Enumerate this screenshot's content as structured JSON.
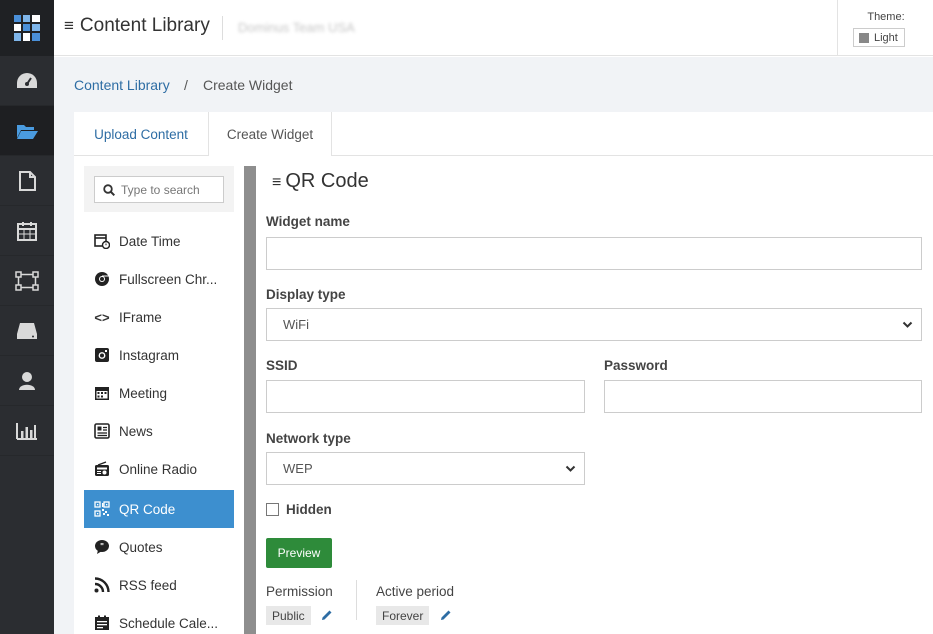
{
  "header": {
    "title": "Content Library",
    "team_name": "Dominus Team USA",
    "theme_label": "Theme:",
    "theme_value": "Light"
  },
  "breadcrumb": {
    "root": "Content Library",
    "separator": "/",
    "current": "Create Widget"
  },
  "tabs": [
    {
      "label": "Upload Content"
    },
    {
      "label": "Create Widget"
    }
  ],
  "widget_list": {
    "search_placeholder": "Type to search",
    "items": [
      {
        "label": "Date Time",
        "icon": "calendar-clock-icon"
      },
      {
        "label": "Fullscreen Chr...",
        "icon": "chrome-icon"
      },
      {
        "label": "IFrame",
        "icon": "code-icon"
      },
      {
        "label": "Instagram",
        "icon": "instagram-icon"
      },
      {
        "label": "Meeting",
        "icon": "calendar-icon"
      },
      {
        "label": "News",
        "icon": "newspaper-icon"
      },
      {
        "label": "Online Radio",
        "icon": "radio-icon"
      },
      {
        "label": "QR Code",
        "icon": "qr-code-icon"
      },
      {
        "label": "Quotes",
        "icon": "quote-icon"
      },
      {
        "label": "RSS feed",
        "icon": "rss-icon"
      },
      {
        "label": "Schedule Cale...",
        "icon": "schedule-icon"
      }
    ],
    "selected": "QR Code"
  },
  "form": {
    "title": "QR Code",
    "widget_name_label": "Widget name",
    "widget_name_value": "",
    "display_type_label": "Display type",
    "display_type_value": "WiFi",
    "ssid_label": "SSID",
    "ssid_value": "",
    "password_label": "Password",
    "password_value": "",
    "network_type_label": "Network type",
    "network_type_value": "WEP",
    "hidden_label": "Hidden",
    "hidden_checked": false,
    "preview_label": "Preview",
    "permission_label": "Permission",
    "permission_value": "Public",
    "active_period_label": "Active period",
    "active_period_value": "Forever"
  },
  "colors": {
    "rail_bg": "#2b2d31",
    "accent": "#3d8fcf",
    "link": "#2e6da4",
    "preview_green": "#2e8b3a"
  },
  "rail_icons": [
    "dashboard-icon",
    "folder-open-icon",
    "file-icon",
    "calendar-icon",
    "network-icon",
    "drive-icon",
    "user-icon",
    "bar-chart-icon"
  ]
}
